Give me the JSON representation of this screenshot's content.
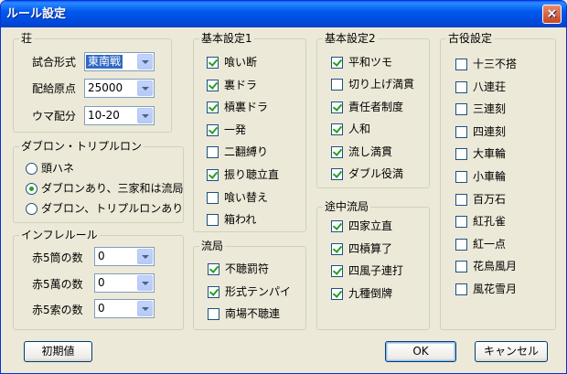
{
  "window": {
    "title": "ルール設定",
    "close_glyph": "×"
  },
  "chan": {
    "legend": "荘",
    "rows": [
      {
        "label": "試合形式",
        "value": "東南戦"
      },
      {
        "label": "配給原点",
        "value": "25000"
      },
      {
        "label": "ウマ配分",
        "value": "10-20"
      }
    ]
  },
  "double_ron": {
    "legend": "ダブロン・トリプルロン",
    "options": [
      {
        "label": "頭ハネ",
        "selected": false
      },
      {
        "label": "ダブロンあり、三家和は流局",
        "selected": true
      },
      {
        "label": "ダブロン、トリプルロンあり",
        "selected": false
      }
    ]
  },
  "inflation": {
    "legend": "インフレルール",
    "rows": [
      {
        "label": "赤5筒の数",
        "value": "0"
      },
      {
        "label": "赤5萬の数",
        "value": "0"
      },
      {
        "label": "赤5索の数",
        "value": "0"
      }
    ]
  },
  "basic1": {
    "legend": "基本設定1",
    "items": [
      {
        "label": "喰い断",
        "checked": true
      },
      {
        "label": "裏ドラ",
        "checked": true
      },
      {
        "label": "槓裏ドラ",
        "checked": true
      },
      {
        "label": "一発",
        "checked": true
      },
      {
        "label": "二翻縛り",
        "checked": false
      },
      {
        "label": "振り聴立直",
        "checked": true
      },
      {
        "label": "喰い替え",
        "checked": false
      },
      {
        "label": "箱われ",
        "checked": false
      }
    ]
  },
  "ryuukyoku": {
    "legend": "流局",
    "items": [
      {
        "label": "不聴罰符",
        "checked": true
      },
      {
        "label": "形式テンパイ",
        "checked": true
      },
      {
        "label": "南場不聴連",
        "checked": false
      }
    ]
  },
  "basic2": {
    "legend": "基本設定2",
    "items": [
      {
        "label": "平和ツモ",
        "checked": true
      },
      {
        "label": "切り上げ満貫",
        "checked": false
      },
      {
        "label": "責任者制度",
        "checked": true
      },
      {
        "label": "人和",
        "checked": true
      },
      {
        "label": "流し満貫",
        "checked": true
      },
      {
        "label": "ダブル役満",
        "checked": true
      }
    ]
  },
  "tochuu": {
    "legend": "途中流局",
    "items": [
      {
        "label": "四家立直",
        "checked": true
      },
      {
        "label": "四槓算了",
        "checked": true
      },
      {
        "label": "四風子連打",
        "checked": true
      },
      {
        "label": "九種倒牌",
        "checked": true
      }
    ]
  },
  "koyaku": {
    "legend": "古役設定",
    "items": [
      {
        "label": "十三不搭",
        "checked": false
      },
      {
        "label": "八連荘",
        "checked": false
      },
      {
        "label": "三連刻",
        "checked": false
      },
      {
        "label": "四連刻",
        "checked": false
      },
      {
        "label": "大車輪",
        "checked": false
      },
      {
        "label": "小車輪",
        "checked": false
      },
      {
        "label": "百万石",
        "checked": false
      },
      {
        "label": "紅孔雀",
        "checked": false
      },
      {
        "label": "紅一点",
        "checked": false
      },
      {
        "label": "花鳥風月",
        "checked": false
      },
      {
        "label": "風花雪月",
        "checked": false
      }
    ]
  },
  "buttons": {
    "reset": "初期値",
    "ok": "OK",
    "cancel": "キャンセル"
  },
  "colors": {
    "titlebar": "#0054E3",
    "face": "#ECE9D8",
    "check": "#21A121",
    "selection": "#316AC5"
  }
}
